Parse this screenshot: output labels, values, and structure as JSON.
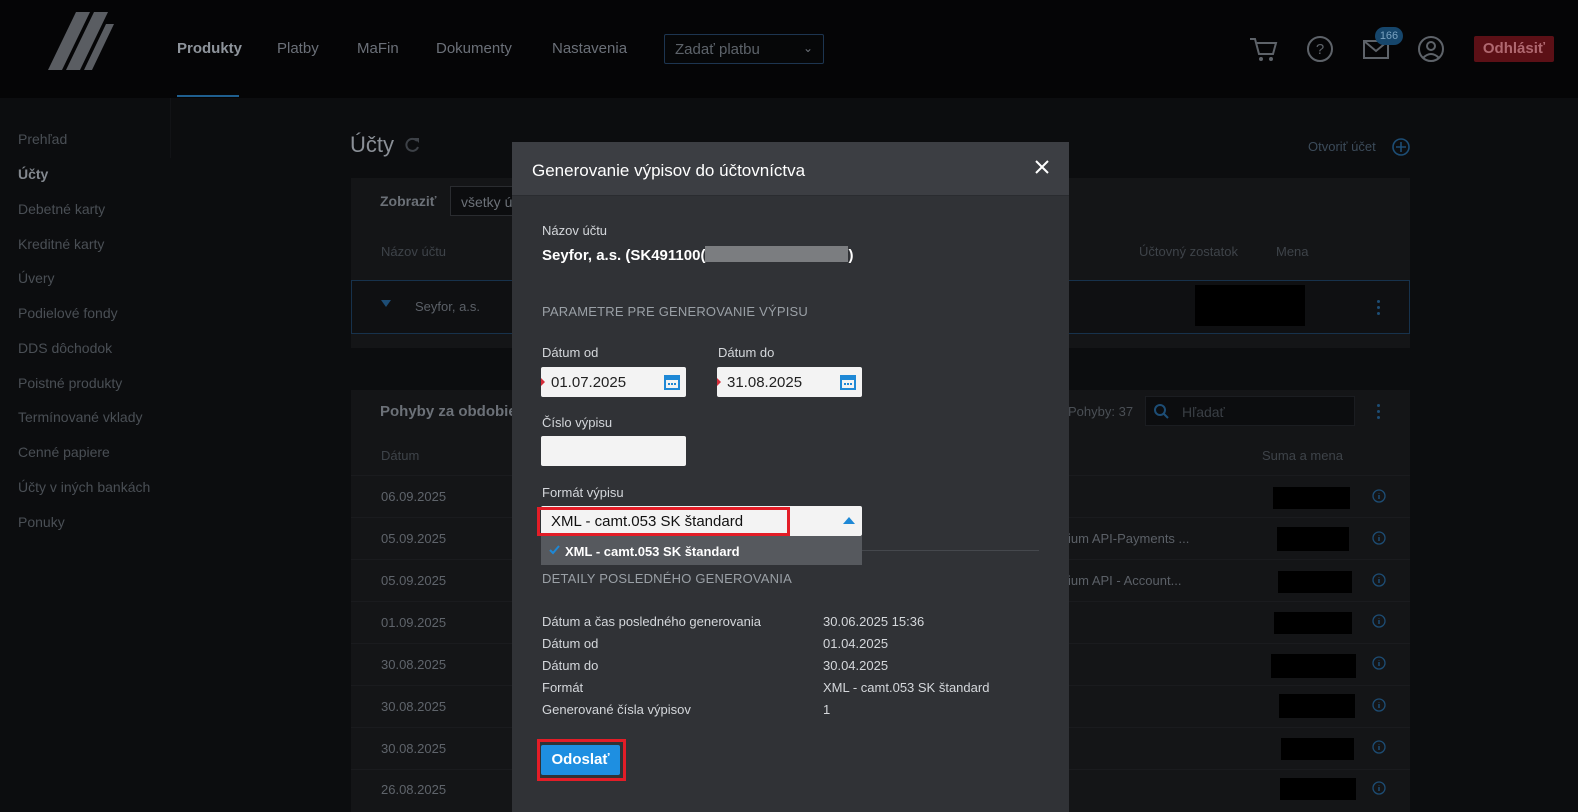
{
  "nav": {
    "items": [
      "Produkty",
      "Platby",
      "MaFin",
      "Dokumenty",
      "Nastavenia"
    ],
    "payment_select": "Zadať platbu",
    "messages_badge": "166",
    "logout": "Odhlásiť"
  },
  "sidebar": {
    "items": [
      "Prehľad",
      "Účty",
      "Debetné karty",
      "Kreditné karty",
      "Úvery",
      "Podielové fondy",
      "DDS dôchodok",
      "Poistné produkty",
      "Termínované vklady",
      "Cenné papiere",
      "Účty v iných bankách",
      "Ponuky"
    ]
  },
  "accounts": {
    "title": "Účty",
    "open_account": "Otvoriť účet",
    "filter_label": "Zobraziť",
    "filter_value": "všetky ú",
    "col_name": "Názov účtu",
    "col_balance": "Účtovný zostatok",
    "col_currency": "Mena",
    "row_name": "Seyfor, a.s."
  },
  "movements": {
    "title": "Pohyby za obdobie",
    "count": "Pohyby: 37",
    "search_placeholder": "Hľadať",
    "col_date": "Dátum",
    "col_amount": "Suma a mena",
    "rows": [
      {
        "date": "06.09.2025",
        "desc": ""
      },
      {
        "date": "05.09.2025",
        "desc": "ium API-Payments ..."
      },
      {
        "date": "05.09.2025",
        "desc": "ium API - Account..."
      },
      {
        "date": "01.09.2025",
        "desc": ""
      },
      {
        "date": "30.08.2025",
        "desc": ""
      },
      {
        "date": "30.08.2025",
        "desc": ""
      },
      {
        "date": "30.08.2025",
        "desc": ""
      },
      {
        "date": "26.08.2025",
        "desc": ""
      }
    ]
  },
  "modal": {
    "title": "Generovanie výpisov do účtovníctva",
    "account_label": "Názov účtu",
    "account_value_prefix": "Seyfor, a.s. (SK491100(",
    "account_value_suffix": ")",
    "params_section": "PARAMETRE PRE GENEROVANIE VÝPISU",
    "date_from_label": "Dátum od",
    "date_from_value": "01.07.2025",
    "date_to_label": "Dátum do",
    "date_to_value": "31.08.2025",
    "statement_number_label": "Číslo výpisu",
    "statement_number_value": "",
    "format_label": "Formát výpisu",
    "format_value": "XML - camt.053 SK štandard",
    "format_options": [
      "XML - camt.053 SK štandard"
    ],
    "details_section": "DETAILY POSLEDNÉHO GENEROVANIA",
    "details": [
      {
        "label": "Dátum a čas posledného generovania",
        "value": "30.06.2025 15:36"
      },
      {
        "label": "Dátum od",
        "value": "01.04.2025"
      },
      {
        "label": "Dátum do",
        "value": "30.04.2025"
      },
      {
        "label": "Formát",
        "value": "XML - camt.053 SK štandard"
      },
      {
        "label": "Generované čísla výpisov",
        "value": "1"
      }
    ],
    "submit": "Odoslať"
  },
  "colors": {
    "accent": "#1e8fe1",
    "highlight": "#e31d27",
    "modal_bg": "#303236",
    "logout_bg": "#5c1016"
  }
}
